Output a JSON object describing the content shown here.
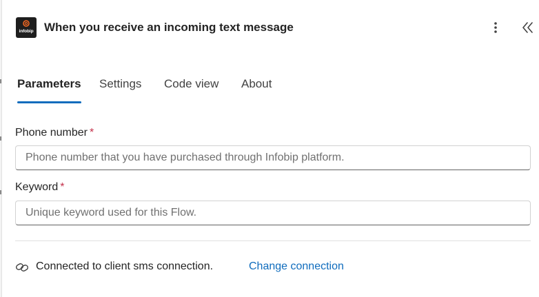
{
  "header": {
    "logo_text": "infobip",
    "title": "When you receive an incoming text message",
    "more_icon": "more-vertical-icon",
    "collapse_icon": "double-chevron-left-icon"
  },
  "tabs": [
    {
      "label": "Parameters",
      "active": true
    },
    {
      "label": "Settings",
      "active": false
    },
    {
      "label": "Code view",
      "active": false
    },
    {
      "label": "About",
      "active": false
    }
  ],
  "fields": {
    "phone": {
      "label": "Phone number",
      "required_mark": "*",
      "value": "",
      "placeholder": "Phone number that you have purchased through Infobip platform."
    },
    "keyword": {
      "label": "Keyword",
      "required_mark": "*",
      "value": "",
      "placeholder": "Unique keyword used for this Flow."
    }
  },
  "connection": {
    "icon": "link-icon",
    "status_text": "Connected to client sms connection.",
    "change_label": "Change connection"
  },
  "colors": {
    "accent": "#0f6cbd",
    "required": "#c4314b",
    "logo_bg": "#1e1e1e",
    "logo_ring": "#f26722"
  }
}
